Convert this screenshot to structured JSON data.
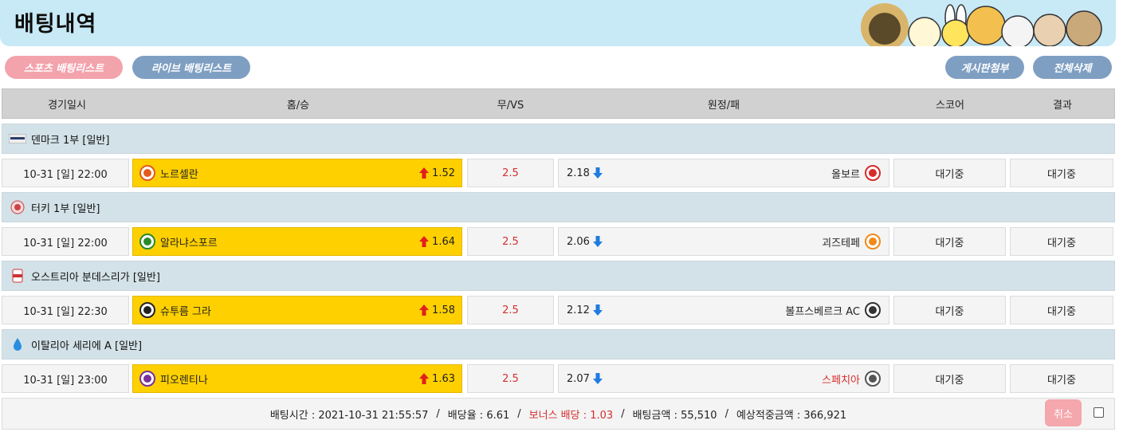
{
  "page": {
    "title": "배팅내역"
  },
  "tabs": {
    "sports": "스포츠 배팅리스트",
    "live": "라이브 배팅리스트",
    "board": "게시판첨부",
    "delete_all": "전체삭제"
  },
  "columns": {
    "date": "경기일시",
    "home": "홈/승",
    "draw": "무/VS",
    "away": "원정/패",
    "score": "스코어",
    "result": "결과"
  },
  "matches": [
    {
      "league": "덴마크 1부 [일반]",
      "league_icon": "denmark-league-icon",
      "date": "10-31 [일] 22:00",
      "home": "노르셀란",
      "home_odds": "1.52",
      "draw": "2.5",
      "away_odds": "2.18",
      "away": "올보르",
      "score": "대기중",
      "result": "대기중",
      "home_color": "#e55a1b",
      "away_color": "#d92b2b",
      "away_red": false
    },
    {
      "league": "터키 1부 [일반]",
      "league_icon": "turkey-league-icon",
      "date": "10-31 [일] 22:00",
      "home": "알라냐스포르",
      "home_odds": "1.64",
      "draw": "2.5",
      "away_odds": "2.06",
      "away": "괴즈테페",
      "score": "대기중",
      "result": "대기중",
      "home_color": "#2a8a2a",
      "away_color": "#f08a1a",
      "away_red": false
    },
    {
      "league": "오스트리아 분데스리가 [일반]",
      "league_icon": "austria-league-icon",
      "date": "10-31 [일] 22:30",
      "home": "슈투름 그라",
      "home_odds": "1.58",
      "draw": "2.5",
      "away_odds": "2.12",
      "away": "볼프스베르크 AC",
      "score": "대기중",
      "result": "대기중",
      "home_color": "#222222",
      "away_color": "#333333",
      "away_red": false
    },
    {
      "league": "이탈리아 세리에 A [일반]",
      "league_icon": "italy-league-icon",
      "date": "10-31 [일] 23:00",
      "home": "피오렌티나",
      "home_odds": "1.63",
      "draw": "2.5",
      "away_odds": "2.07",
      "away": "스페치아",
      "score": "대기중",
      "result": "대기중",
      "home_color": "#7a2f9a",
      "away_color": "#555555",
      "away_red": true
    }
  ],
  "summary": {
    "time": "배팅시간 : 2021-10-31 21:55:57",
    "rate": "배당율 : 6.61",
    "bonus": "보너스 배당 : 1.03",
    "amount": "배팅금액 : 55,510",
    "expected": "예상적중금액 : 366,921",
    "cancel": "취소"
  },
  "colors": {
    "banner": "#c8e9f6",
    "home_cell": "#ffd000",
    "up_arrow": "#e02020",
    "down_arrow": "#1e7be0",
    "draw_text": "#d42f2f"
  }
}
